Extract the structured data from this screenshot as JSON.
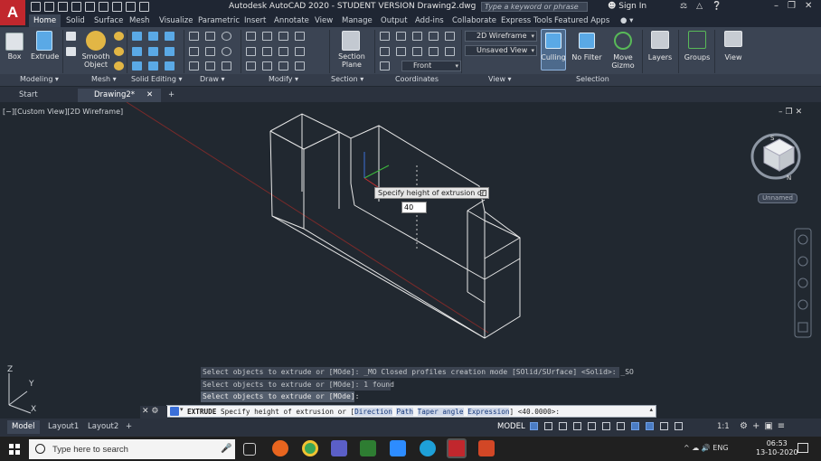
{
  "window": {
    "app_logo": "A",
    "title": "Autodesk AutoCAD 2020 - STUDENT VERSION   Drawing2.dwg",
    "search_placeholder": "Type a keyword or phrase",
    "sign_in": "Sign In"
  },
  "ribbon_tabs": [
    "Home",
    "Solid",
    "Surface",
    "Mesh",
    "Visualize",
    "Parametric",
    "Insert",
    "Annotate",
    "View",
    "Manage",
    "Output",
    "Add-ins",
    "Collaborate",
    "Express Tools",
    "Featured Apps"
  ],
  "active_tab": "Home",
  "ribbon": {
    "big_buttons": {
      "box": "Box",
      "extrude": "Extrude",
      "smooth_object": "Smooth Object",
      "section_plane": "Section Plane",
      "culling": "Culling",
      "no_filter": "No Filter",
      "move_gizmo": "Move Gizmo",
      "layers": "Layers",
      "groups": "Groups",
      "view": "View"
    },
    "dropdowns": {
      "visual_style": "2D Wireframe",
      "saved_view": "Unsaved View",
      "front": "Front"
    },
    "panels": [
      "Modeling",
      "Mesh",
      "Solid Editing",
      "Draw",
      "Modify",
      "Section",
      "Coordinates",
      "View",
      "Selection"
    ]
  },
  "doc_tabs": {
    "start": "Start",
    "drawing": "Drawing2*"
  },
  "viewport": {
    "controls": "[−][Custom View][2D Wireframe]",
    "viewcube_label": "Unnamed",
    "tooltip": "Specify height of extrusion or",
    "dynamic_input": "40"
  },
  "command": {
    "history": [
      "Select objects to extrude or [MOde]: _MO Closed profiles creation mode [SOlid/SUrface] <Solid>: _SO",
      "Select objects to extrude or [MOde]: 1 found",
      "Select objects to extrude or [MOde]:"
    ],
    "cmd_name": "EXTRUDE",
    "prompt": "Specify height of extrusion or",
    "options": [
      "Direction",
      "Path",
      "Taper angle",
      "Expression"
    ],
    "default": "<40.0000>:"
  },
  "layout_tabs": [
    "Model",
    "Layout1",
    "Layout2"
  ],
  "status": {
    "model": "MODEL",
    "scale": "1:1"
  },
  "taskbar": {
    "search": "Type here to search",
    "language": "ENG",
    "time": "06:53",
    "date": "13-10-2020"
  },
  "colors": {
    "viewport_bg": "#212830",
    "ribbon_bg": "#3b4453",
    "wireframe": "#e8e8e8",
    "autocad_red": "#c1272d"
  }
}
